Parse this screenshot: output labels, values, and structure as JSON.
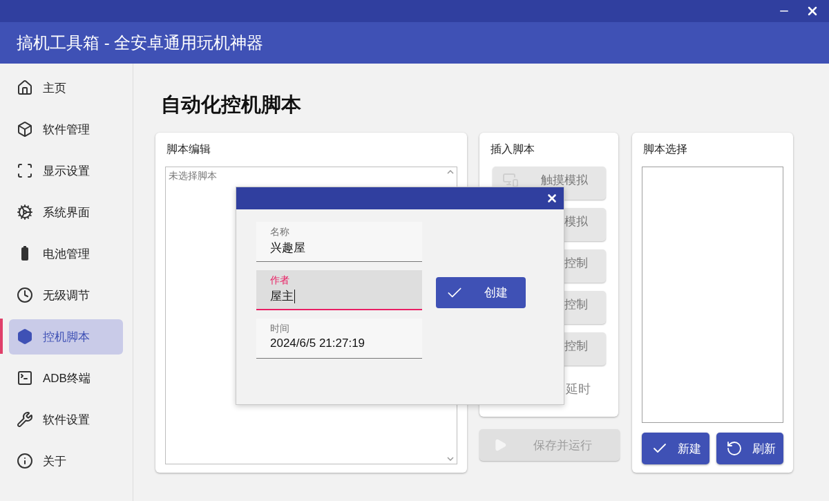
{
  "window": {
    "title": "搞机工具箱 - 全安卓通用玩机神器"
  },
  "sidebar": {
    "items": [
      {
        "label": "主页",
        "selected": false
      },
      {
        "label": "软件管理",
        "selected": false
      },
      {
        "label": "显示设置",
        "selected": false
      },
      {
        "label": "系统界面",
        "selected": false
      },
      {
        "label": "电池管理",
        "selected": false
      },
      {
        "label": "无级调节",
        "selected": false
      },
      {
        "label": "控机脚本",
        "selected": true
      },
      {
        "label": "ADB终端",
        "selected": false
      },
      {
        "label": "软件设置",
        "selected": false
      },
      {
        "label": "关于",
        "selected": false
      }
    ]
  },
  "page": {
    "title": "自动化控机脚本"
  },
  "editor": {
    "title": "脚本编辑",
    "placeholder": "未选择脚本"
  },
  "insert": {
    "title": "插入脚本",
    "items": [
      {
        "kind": "button",
        "label": "触摸模拟",
        "disabled": true
      },
      {
        "kind": "button",
        "label": "模拟",
        "disabled": true
      },
      {
        "kind": "button",
        "label": "控制",
        "disabled": true
      },
      {
        "kind": "button",
        "label": "控制",
        "disabled": true
      },
      {
        "kind": "button",
        "label": "控制",
        "disabled": true
      },
      {
        "kind": "text",
        "label": "延时",
        "disabled": true
      }
    ]
  },
  "save_run": {
    "label": "保存并运行",
    "disabled": true
  },
  "select": {
    "title": "脚本选择",
    "buttons": [
      {
        "label": "新建"
      },
      {
        "label": "刷新"
      }
    ]
  },
  "dialog": {
    "fields": [
      {
        "label": "名称",
        "value": "兴趣屋",
        "focused": false
      },
      {
        "label": "作者",
        "value": "屋主",
        "focused": true
      },
      {
        "label": "时间",
        "value": "2024/6/5 21:27:19",
        "focused": false
      }
    ],
    "create": {
      "label": "创建"
    }
  }
}
